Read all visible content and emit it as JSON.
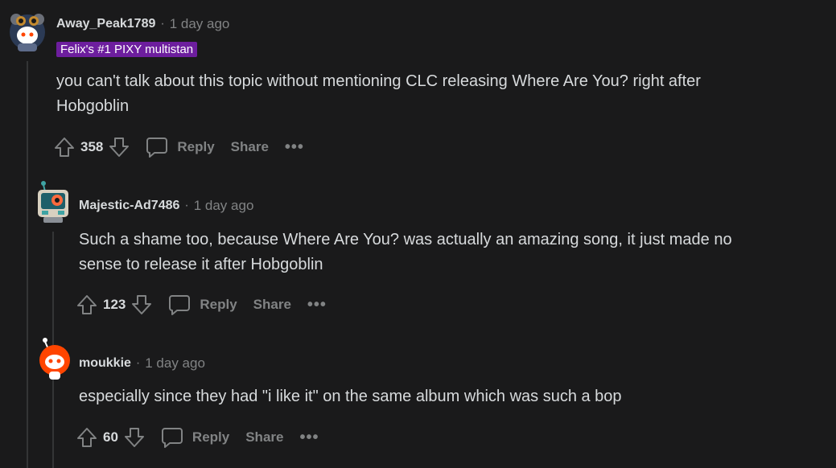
{
  "comments": [
    {
      "username": "Away_Peak1789",
      "time": "1 day ago",
      "flair": "Felix's #1 PIXY multistan",
      "body_lines": [
        "you can't talk about this topic without mentioning CLC releasing Where Are You? right after",
        "Hobgoblin"
      ],
      "score": "358",
      "reply": "Reply",
      "share": "Share",
      "more": "•••",
      "avatar_icon": "snoo-avatar-icon"
    },
    {
      "username": "Majestic-Ad7486",
      "time": "1 day ago",
      "body_lines": [
        "Such a shame too, because Where Are You? was actually an amazing song, it just made no",
        "sense to release it after Hobgoblin"
      ],
      "score": "123",
      "reply": "Reply",
      "share": "Share",
      "more": "•••",
      "avatar_icon": "robot-avatar-icon"
    },
    {
      "username": "moukkie",
      "time": "1 day ago",
      "body_lines": [
        "especially since they had \"i like it\" on the same album which was such a bop"
      ],
      "score": "60",
      "reply": "Reply",
      "share": "Share",
      "more": "•••",
      "avatar_icon": "snoo-avatar-icon"
    }
  ],
  "separator": "·",
  "colors": {
    "background": "#1a1a1b",
    "text": "#d7dadc",
    "muted": "#818384",
    "flair_bg": "#6d1e9e",
    "thread_line": "#343536"
  }
}
